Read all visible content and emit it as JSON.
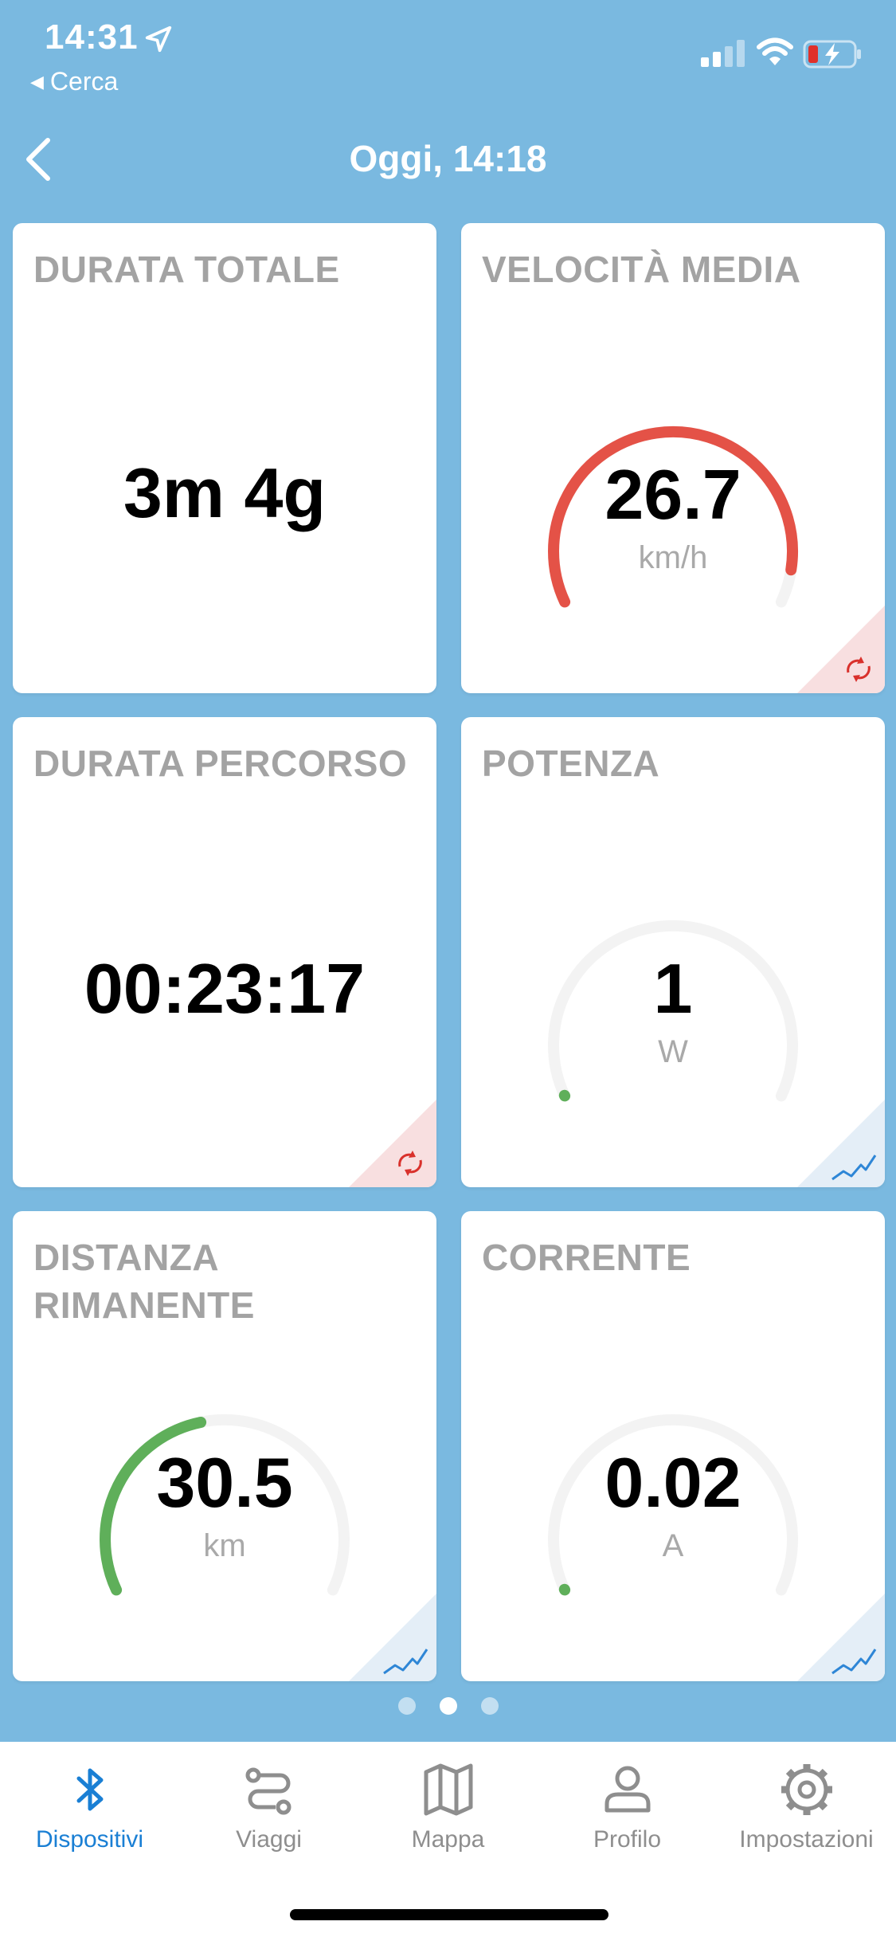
{
  "status": {
    "time": "14:31",
    "back_app": "Cerca"
  },
  "nav": {
    "title": "Oggi, 14:18"
  },
  "cards": [
    {
      "title": "DURATA TOTALE",
      "value": "3m 4g",
      "unit": "",
      "corner": "none"
    },
    {
      "title": "VELOCITÀ MEDIA",
      "value": "26.7",
      "unit": "km/h",
      "corner": "refresh-icon",
      "gauge_level": 0.93,
      "gauge_color": "#e45247"
    },
    {
      "title": "DURATA PERCORSO",
      "value": "00:23:17",
      "unit": "",
      "corner": "refresh-icon"
    },
    {
      "title": "POTENZA",
      "value": "1",
      "unit": "W",
      "corner": "chart-line-icon",
      "gauge_level": 0.0,
      "gauge_color": "#5faf5a"
    },
    {
      "title": "DISTANZA RIMANENTE",
      "value": "30.5",
      "unit": "km",
      "corner": "chart-line-icon",
      "gauge_level": 0.45,
      "gauge_color": "#5faf5a"
    },
    {
      "title": "CORRENTE",
      "value": "0.02",
      "unit": "A",
      "corner": "chart-line-icon",
      "gauge_level": 0.0,
      "gauge_color": "#5faf5a"
    }
  ],
  "pager": {
    "count": 3,
    "active": 2
  },
  "tabs": [
    {
      "label": "Dispositivi",
      "icon": "bluetooth-icon",
      "active": true
    },
    {
      "label": "Viaggi",
      "icon": "route-icon",
      "active": false
    },
    {
      "label": "Mappa",
      "icon": "map-icon",
      "active": false
    },
    {
      "label": "Profilo",
      "icon": "person-icon",
      "active": false
    },
    {
      "label": "Impostazioni",
      "icon": "gear-icon",
      "active": false
    }
  ],
  "colors": {
    "background": "#7ab9e0",
    "accent": "#1a7fd4",
    "tab_inactive": "#8e8e8e",
    "card_title": "#a3a3a3",
    "gauge_track": "#f3f3f3"
  }
}
